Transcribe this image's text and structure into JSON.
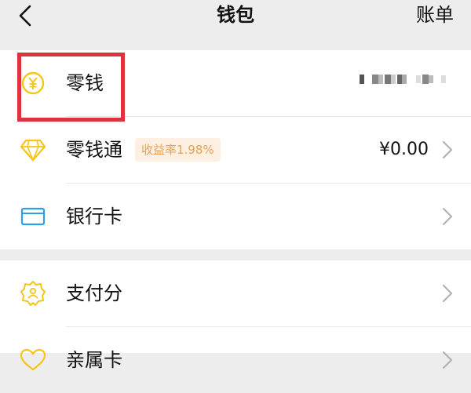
{
  "header": {
    "title": "钱包",
    "right_label": "账单"
  },
  "wallet_items": [
    {
      "label": "零钱",
      "value": ""
    },
    {
      "label": "零钱通",
      "badge": "收益率1.98%",
      "value": "¥0.00"
    },
    {
      "label": "银行卡"
    }
  ],
  "services": [
    {
      "label": "支付分"
    },
    {
      "label": "亲属卡"
    }
  ],
  "colors": {
    "accent_yellow": "#f5c518",
    "icon_blue": "#2f9ee8",
    "badge_bg": "#fdf0e2",
    "badge_text": "#e9a050",
    "highlight_red": "#e0323e",
    "page_bg": "#ededed"
  }
}
